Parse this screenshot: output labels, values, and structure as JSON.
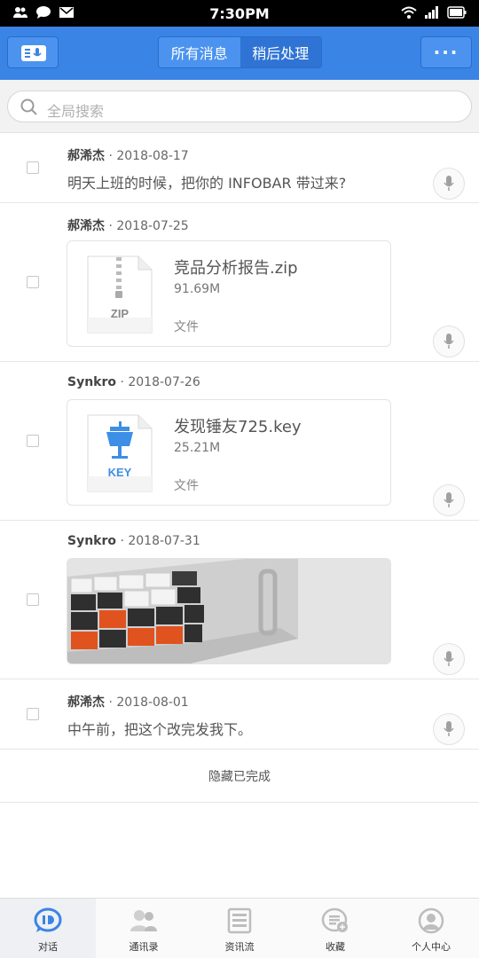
{
  "status_bar": {
    "time": "7:30PM"
  },
  "header": {
    "tabs": [
      {
        "label": "所有消息",
        "active": true
      },
      {
        "label": "稍后处理",
        "active": false
      }
    ],
    "more_label": "···"
  },
  "search": {
    "placeholder": "全局搜索"
  },
  "messages": [
    {
      "sender": "郝浠杰",
      "date": " · 2018-08-17",
      "text": "明天上班的时候，把你的 INFOBAR 带过来?"
    },
    {
      "sender": "郝浠杰",
      "date": " · 2018-07-25",
      "file": {
        "name": "竞品分析报告.zip",
        "size": "91.69M",
        "type": "文件",
        "icon_label": "ZIP"
      }
    },
    {
      "sender": "Synkro",
      "date": " · 2018-07-26",
      "file": {
        "name": "发现锤友725.key",
        "size": "25.21M",
        "type": "文件",
        "icon_label": "KEY"
      }
    },
    {
      "sender": "Synkro",
      "date": " · 2018-07-31",
      "image": "keyboard-photo"
    },
    {
      "sender": "郝浠杰",
      "date": " · 2018-08-01",
      "text": "中午前，把这个改完发我下。"
    }
  ],
  "hide_completed_label": "隐藏已完成",
  "bottom_nav": [
    {
      "label": "对话",
      "icon": "chat-icon",
      "active": true
    },
    {
      "label": "通讯录",
      "icon": "contacts-icon",
      "active": false
    },
    {
      "label": "资讯流",
      "icon": "news-icon",
      "active": false
    },
    {
      "label": "收藏",
      "icon": "favorites-icon",
      "active": false
    },
    {
      "label": "个人中心",
      "icon": "profile-icon",
      "active": false
    }
  ],
  "colors": {
    "accent": "#3a84e6",
    "key_blue": "#3d8ee6"
  }
}
